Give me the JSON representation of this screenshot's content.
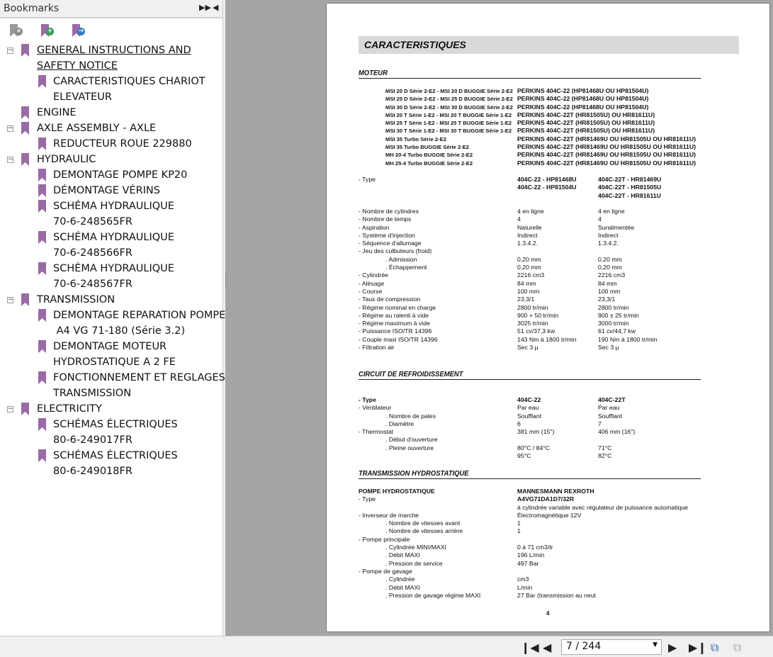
{
  "sidebar": {
    "title": "Bookmarks",
    "expand_icon": "double-chevron-right-icon",
    "collapse_icon": "triangle-left-icon",
    "tools": [
      {
        "name": "delete-bookmark",
        "icon": "bookmark-delete-icon"
      },
      {
        "name": "add-bookmark",
        "icon": "bookmark-add-icon"
      },
      {
        "name": "goto-bookmark",
        "icon": "bookmark-goto-icon"
      }
    ],
    "items": [
      {
        "label": "GENERAL INSTRUCTIONS AND\nSAFETY NOTICE",
        "level": 0,
        "expanded": true,
        "selected": true
      },
      {
        "label": "CARACTERISTIQUES CHARIOT\nELEVATEUR",
        "level": 1
      },
      {
        "label": "ENGINE",
        "level": 0
      },
      {
        "label": "AXLE ASSEMBLY - AXLE",
        "level": 0,
        "expanded": true
      },
      {
        "label": "REDUCTEUR ROUE 229880",
        "level": 1
      },
      {
        "label": "HYDRAULIC",
        "level": 0,
        "expanded": true
      },
      {
        "label": "DEMONTAGE POMPE KP20",
        "level": 1
      },
      {
        "label": "DÉMONTAGE VÉRINS",
        "level": 1
      },
      {
        "label": "SCHÉMA HYDRAULIQUE\n70-6-248565FR",
        "level": 1
      },
      {
        "label": "SCHÉMA HYDRAULIQUE\n70-6-248566FR",
        "level": 1
      },
      {
        "label": "SCHÉMA HYDRAULIQUE\n70-6-248567FR",
        "level": 1
      },
      {
        "label": "TRANSMISSION",
        "level": 0,
        "expanded": true
      },
      {
        "label": "DEMONTAGE REPARATION POMPE\n A4 VG 71-180 (Série 3.2)",
        "level": 1
      },
      {
        "label": "DEMONTAGE MOTEUR\nHYDROSTATIQUE A 2 FE",
        "level": 1
      },
      {
        "label": "FONCTIONNEMENT ET REGLAGES\nTRANSMISSION",
        "level": 1
      },
      {
        "label": "ELECTRICITY",
        "level": 0,
        "expanded": true
      },
      {
        "label": "SCHÉMAS ÉLECTRIQUES\n80-6-249017FR",
        "level": 1
      },
      {
        "label": "SCHÉMAS ÉLECTRIQUES\n80-6-249018FR",
        "level": 1
      }
    ]
  },
  "document": {
    "title": "CARACTERISTIQUES",
    "moteur": {
      "heading": "MOTEUR",
      "models": [
        "MSI 20 D Série 2-E2 - MSI 20 D BUGGIE Série 2-E2",
        "MSI 25 D Série 2-E2 - MSI 25 D BUGGIE Série 2-E2",
        "MSI 30 D Série 2-E2 - MSI 30 D BUGGIE Série 2-E2",
        "MSI 20 T Série 1-E2 - MSI 20 T BUGGIE Série 1-E2",
        "MSI 25 T Série 1-E2 - MSI 25 T BUGGIE Série 1-E2",
        "MSI 30 T Série 1-E2 - MSI 30 T BUGGIE Série 1-E2",
        "MSI 35 Turbo Série 2-E2",
        "MSI 35 Turbo BUGGIE Série 2-E2",
        "MH 20-4 Turbo BUGGIE Série 2-E2",
        "MH 25-4 Turbo BUGGIE Série 2-E2"
      ],
      "engines": [
        "PERKINS 404C-22 (HP81468U OU HP81504U)",
        "PERKINS 404C-22 (HP81468U OU HP81504U)",
        "PERKINS 404C-22 (HP81468U OU HP81504U)",
        "PERKINS 404C-22T (HR81505U) OU HR81611U)",
        "PERKINS 404C-22T (HR81505U) OU HR81611U)",
        "PERKINS 404C-22T (HR81505U) OU HR81611U)",
        "PERKINS 404C-22T (HR81469U OU HR81505U OU HR81611U)",
        "PERKINS 404C-22T (HR81469U OU HR81505U OU HR81611U)",
        "PERKINS 404C-22T (HR81469U OU HR81505U OU HR81611U)",
        "PERKINS 404C-22T (HR81469U OU HR81505U OU HR81611U)"
      ],
      "type": {
        "label": "- Type",
        "v1": "404C-22 - HP81468U\n404C-22 - HP81504U",
        "v2": "404C-22T - HR81469U\n404C-22T - HR81505U\n404C-22T - HR81611U"
      },
      "rows": [
        {
          "label": "- Nombre de cylindres",
          "v1": "4 en ligne",
          "v2": "4 en ligne"
        },
        {
          "label": "- Nombre de temps",
          "v1": "4",
          "v2": "4"
        },
        {
          "label": "- Aspiration",
          "v1": "Naturelle",
          "v2": "Suralimentée"
        },
        {
          "label": "- Système d'injection",
          "v1": "Indirect",
          "v2": "Indirect"
        },
        {
          "label": "- Séquence d'allumage",
          "v1": "1.3.4.2.",
          "v2": "1.3.4.2."
        },
        {
          "label": "- Jeu des culbuteurs (froid)",
          "v1": "",
          "v2": ""
        },
        {
          "label": ". Admission",
          "indent": true,
          "v1": "0,20 mm",
          "v2": "0,20 mm"
        },
        {
          "label": ". Échappement",
          "indent": true,
          "v1": "0,20 mm",
          "v2": "0,20 mm"
        },
        {
          "label": "- Cylindrée",
          "v1": "2216 cm3",
          "v2": "2216 cm3"
        },
        {
          "label": "- Alésage",
          "v1": "84 mm",
          "v2": "84 mm"
        },
        {
          "label": "- Course",
          "v1": "100 mm",
          "v2": "100 mm"
        },
        {
          "label": "- Taux de compression",
          "v1": "23,3/1",
          "v2": "23,3/1"
        },
        {
          "label": "- Régime nominal en charge",
          "v1": "2800 tr/min",
          "v2": "2800 tr/min"
        },
        {
          "label": "- Régime au ralenti à vide",
          "v1": "900 + 50 tr/min",
          "v2": "900 ± 25 tr/min"
        },
        {
          "label": "- Régime maximum à vide",
          "v1": "3025 tr/min",
          "v2": "3000 tr/min"
        },
        {
          "label": "- Puissance ISO/TR 14396",
          "v1": "51 cv/37,3 kw",
          "v2": "61 cv/44,7 kw"
        },
        {
          "label": "- Couple maxi ISO/TR 14396",
          "v1": "143 Nm à 1800 tr/min",
          "v2": "190 Nm à 1800 tr/min"
        },
        {
          "label": "- Filtration air",
          "v1": "Sec 3 µ",
          "v2": "Sec 3 µ"
        }
      ]
    },
    "refroidissement": {
      "heading": "CIRCUIT DE REFROIDISSEMENT",
      "rows": [
        {
          "label": "- Type",
          "v1": "404C-22",
          "v2": "404C-22T",
          "bold": true
        },
        {
          "label": "- Ventilateur",
          "v1": "Par eau",
          "v2": "Par eau"
        },
        {
          "label": ". Nombre de pales",
          "indent": true,
          "v1": "Soufflant",
          "v2": "Soufflant"
        },
        {
          "label": ". Diamètre",
          "indent": true,
          "v1": "6",
          "v2": "7"
        },
        {
          "label": "- Thermostat",
          "v1": "381 mm (15\")",
          "v2": "406 mm (16\")"
        },
        {
          "label": ". Début d'ouverture",
          "indent": true,
          "v1": "",
          "v2": ""
        },
        {
          "label": ". Pleine ouverture",
          "indent": true,
          "v1": "80°C / 84°C\n95°C",
          "v2": "71°C\n82°C"
        }
      ]
    },
    "transmission": {
      "heading": "TRANSMISSION HYDROSTATIQUE",
      "rows": [
        {
          "label": "POMPE HYDROSTATIQUE",
          "v1": "MANNESMANN REXROTH",
          "bold": true
        },
        {
          "label": "- Type",
          "v1": "A4VG71DA1D7/32R",
          "v1bold": true
        },
        {
          "label": "",
          "v1": "à cylindrée variable avec régulateur de puissance automatique"
        },
        {
          "label": "- Inverseur de marche",
          "v1": "Électromagnétique 12V"
        },
        {
          "label": ". Nombre de vitesses avant",
          "indent": true,
          "v1": "1"
        },
        {
          "label": ". Nombre de vitesses arrière",
          "indent": true,
          "v1": "1"
        },
        {
          "label": "- Pompe principale",
          "v1": ""
        },
        {
          "label": ". Cylindrée MINI/MAXI",
          "indent": true,
          "v1": "0 à 71 cm3/tr"
        },
        {
          "label": ". Débit MAXI",
          "indent": true,
          "v1": "196 L/min"
        },
        {
          "label": ". Pression de service",
          "indent": true,
          "v1": "497 Bar"
        },
        {
          "label": "- Pompe de gavage",
          "v1": ""
        },
        {
          "label": ". Cylindrée",
          "indent": true,
          "v1": "cm3"
        },
        {
          "label": ". Débit MAXI",
          "indent": true,
          "v1": "L/min"
        },
        {
          "label": ". Pression de gavage régime MAXI",
          "indent": true,
          "v1": "27 Bar (transmission au neut"
        }
      ]
    },
    "page_number": "4"
  },
  "toolbar": {
    "page_indicator": "7 / 244",
    "current_page": 7,
    "total_pages": 244,
    "icons": [
      "first-page-icon",
      "previous-page-icon",
      "next-page-icon",
      "last-page-icon",
      "previous-view-icon",
      "next-view-icon"
    ]
  },
  "colors": {
    "bookmark": "#9a6aa6",
    "viewer_bg": "#a5a5a5"
  }
}
